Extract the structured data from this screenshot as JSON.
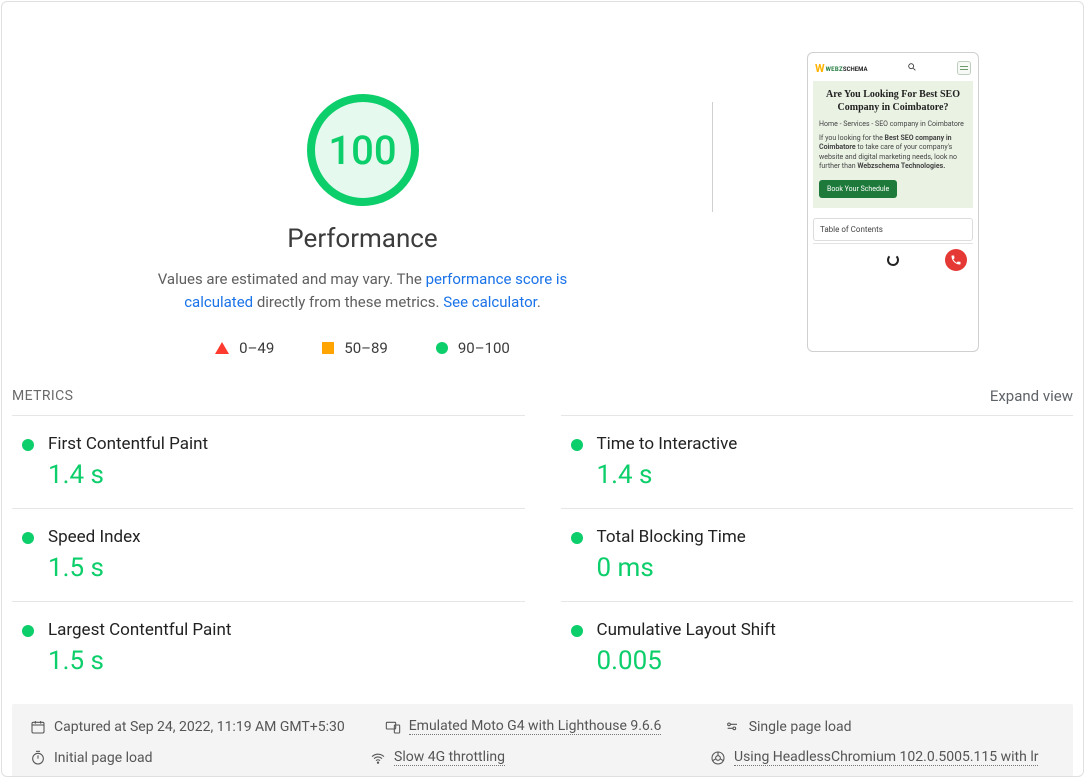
{
  "gauge": {
    "score": "100",
    "title": "Performance"
  },
  "description": {
    "prefix": "Values are estimated and may vary. The ",
    "link1": "performance score is calculated",
    "middle": " directly from these metrics. ",
    "link2": "See calculator",
    "suffix": "."
  },
  "legend": {
    "r0": "0–49",
    "r1": "50–89",
    "r2": "90–100"
  },
  "preview": {
    "logo_w": "W",
    "logo_a": "WEBZ",
    "logo_b": "SCHEMA",
    "title": "Are You Looking For Best SEO Company in Coimbatore?",
    "breadcrumb": "Home - Services - SEO company in Coimbatore",
    "body_prefix": "If you looking for the ",
    "body_bold1": "Best SEO company in Coimbatore",
    "body_mid": " to take care of your company's website and digital marketing needs, look no further than ",
    "body_bold2": "Webzschema Technologies.",
    "cta": "Book Your Schedule",
    "toc": "Table of Contents"
  },
  "section": {
    "title": "METRICS",
    "expand": "Expand view"
  },
  "metrics": [
    {
      "label": "First Contentful Paint",
      "value": "1.4 s"
    },
    {
      "label": "Time to Interactive",
      "value": "1.4 s"
    },
    {
      "label": "Speed Index",
      "value": "1.5 s"
    },
    {
      "label": "Total Blocking Time",
      "value": "0 ms"
    },
    {
      "label": "Largest Contentful Paint",
      "value": "1.5 s"
    },
    {
      "label": "Cumulative Layout Shift",
      "value": "0.005"
    }
  ],
  "footer": {
    "captured": "Captured at Sep 24, 2022, 11:19 AM GMT+5:30",
    "emulated": "Emulated Moto G4 with Lighthouse 9.6.6",
    "single": "Single page load",
    "initial": "Initial page load",
    "throttle": "Slow 4G throttling",
    "chromium": "Using HeadlessChromium 102.0.5005.115 with lr"
  }
}
